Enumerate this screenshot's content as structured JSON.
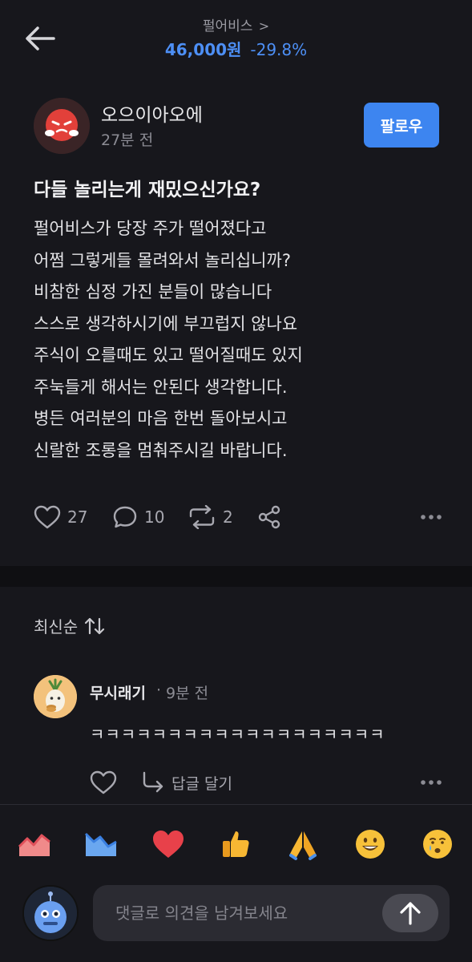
{
  "header": {
    "stock_name": "펄어비스",
    "stock_chevron": ">",
    "price": "46,000원",
    "change": "-29.8%"
  },
  "post": {
    "author": "오으이아오에",
    "time": "27분 전",
    "follow_label": "팔로우",
    "title": "다들 놀리는게 재밌으신가요?",
    "body_lines": [
      "펄어비스가 당장 주가 떨어졌다고",
      "어쩜 그렇게들 몰려와서 놀리십니까?",
      "비참한 심정 가진 분들이 많습니다",
      "스스로 생각하시기에 부끄럽지 않나요",
      "주식이 오를때도 있고 떨어질때도 있지",
      "주눅들게 해서는 안된다 생각합니다.",
      "병든 여러분의 마음 한번 돌아보시고",
      "신랄한 조롱을 멈춰주시길 바랍니다."
    ],
    "likes": "27",
    "comments": "10",
    "reposts": "2"
  },
  "comments_section": {
    "sort_label": "최신순"
  },
  "comment": {
    "author": "무시래기",
    "separator": "·",
    "time": "9분 전",
    "text": "ㅋㅋㅋㅋㅋㅋㅋㅋㅋㅋㅋㅋㅋㅋㅋㅋㅋㅋㅋ",
    "reply_label": "답글 달기"
  },
  "composer": {
    "placeholder": "댓글로 의견을 남겨보세요"
  },
  "reactions": [
    "chart-up-icon",
    "chart-down-icon",
    "heart-icon",
    "thumbs-up-icon",
    "pray-icon",
    "smile-icon",
    "crying-icon"
  ],
  "colors": {
    "accent_blue": "#3d85f0",
    "price_blue": "#4d8ff5",
    "background": "#17171c"
  }
}
